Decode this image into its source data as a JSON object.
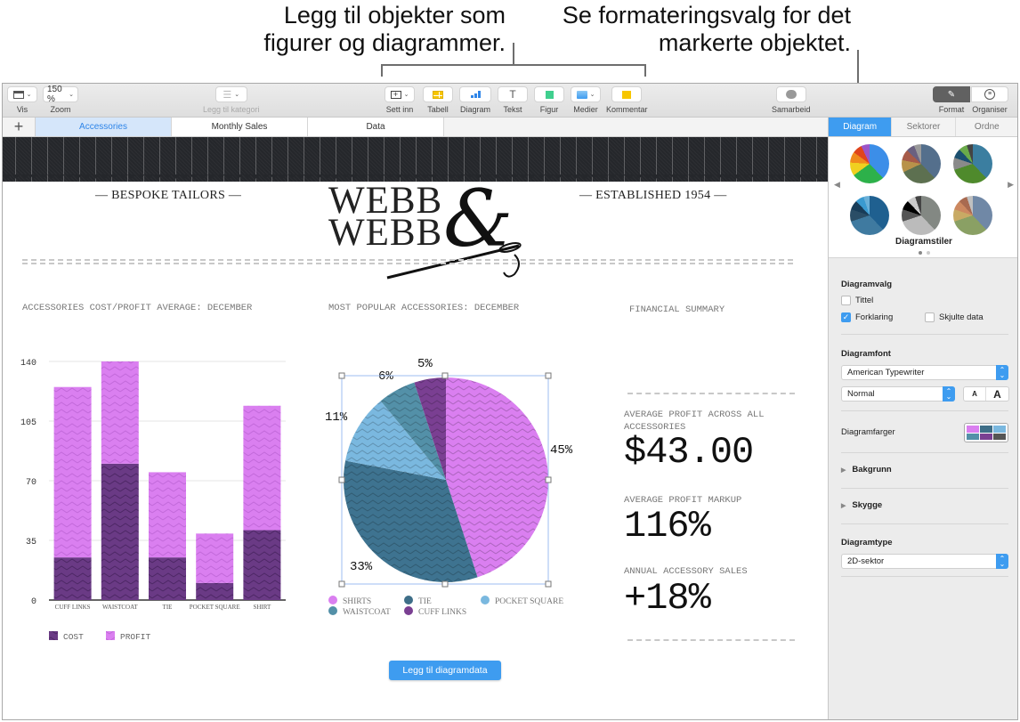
{
  "callouts": {
    "left_line1": "Legg til objekter som",
    "left_line2": "figurer og diagrammer.",
    "right_line1": "Se formateringsvalg for det",
    "right_line2": "markerte objektet."
  },
  "toolbar": {
    "view": {
      "label": "Vis",
      "icon": "sidebar-view-icon"
    },
    "zoom": {
      "label": "Zoom",
      "value": "150 %"
    },
    "category": {
      "label": "Legg til kategori",
      "icon": "list-icon"
    },
    "insert": {
      "label": "Sett inn",
      "icon": "insert-icon"
    },
    "table": {
      "label": "Tabell",
      "icon": "table-icon"
    },
    "chart": {
      "label": "Diagram",
      "icon": "bar-chart-icon"
    },
    "text": {
      "label": "Tekst",
      "icon": "text-icon",
      "glyph": "T"
    },
    "shape": {
      "label": "Figur",
      "icon": "shape-icon"
    },
    "media": {
      "label": "Medier",
      "icon": "media-icon"
    },
    "comment": {
      "label": "Kommentar",
      "icon": "comment-icon"
    },
    "collaborate": {
      "label": "Samarbeid",
      "icon": "collaborate-icon"
    },
    "format": {
      "label": "Format",
      "icon": "paintbrush-icon"
    },
    "organize": {
      "label": "Organiser",
      "icon": "organize-icon"
    }
  },
  "sheet_tabs": {
    "add": "+",
    "tabs": [
      {
        "label": "Accessories",
        "active": true
      },
      {
        "label": "Monthly Sales",
        "active": false
      },
      {
        "label": "Data",
        "active": false
      }
    ]
  },
  "document": {
    "tagline_left": "— BESPOKE TAILORS —",
    "tagline_right": "— ESTABLISHED 1954 —",
    "logo_line1": "WEBB",
    "logo_line2": "WEBB",
    "logo_amp": "&",
    "bar_chart_title": "ACCESSORIES COST/PROFIT AVERAGE: DECEMBER",
    "pie_chart_title": "MOST POPULAR ACCESSORIES: DECEMBER",
    "financial_title": "FINANCIAL SUMMARY",
    "financial": [
      {
        "label": "AVERAGE PROFIT ACROSS ALL ACCESSORIES",
        "value": "$43.00"
      },
      {
        "label": "AVERAGE PROFIT MARKUP",
        "value": "116%"
      },
      {
        "label": "ANNUAL ACCESSORY SALES",
        "value": "+18%"
      }
    ],
    "add_chart_data_button": "Legg til diagramdata"
  },
  "chart_data": [
    {
      "type": "bar",
      "stacked": true,
      "title": "ACCESSORIES COST/PROFIT AVERAGE: DECEMBER",
      "categories": [
        "CUFF LINKS",
        "WAISTCOAT",
        "TIE",
        "POCKET SQUARE",
        "SHIRT"
      ],
      "series": [
        {
          "name": "COST",
          "values": [
            25,
            80,
            25,
            10,
            41
          ],
          "color": "#6a3a85"
        },
        {
          "name": "PROFIT",
          "values": [
            100,
            60,
            50,
            29,
            73
          ],
          "color": "#da7ff0"
        }
      ],
      "yticks": [
        "0",
        "35",
        "70",
        "105",
        "140"
      ],
      "ylim": [
        0,
        140
      ],
      "grid": true,
      "legend": "bottom-left"
    },
    {
      "type": "pie",
      "title": "MOST POPULAR ACCESSORIES: DECEMBER",
      "slices": [
        {
          "name": "SHIRTS",
          "value": 45,
          "label": "45%",
          "color": "#da7ff0"
        },
        {
          "name": "WAISTCOAT",
          "value": 33,
          "label": "33%",
          "color": "#3e7390"
        },
        {
          "name": "POCKET SQUARE",
          "value": 11,
          "label": "11%",
          "color": "#7ab8df"
        },
        {
          "name": "TIE",
          "value": 6,
          "label": "6%",
          "color": "#5390a8"
        },
        {
          "name": "CUFF LINKS",
          "value": 5,
          "label": "5%",
          "color": "#7a3f92"
        }
      ],
      "legend_order": [
        {
          "name": "SHIRTS",
          "color": "#da7ff0"
        },
        {
          "name": "TIE",
          "color": "#3e6e88"
        },
        {
          "name": "POCKET SQUARE",
          "color": "#7ab8df"
        },
        {
          "name": "WAISTCOAT",
          "color": "#5390a8"
        },
        {
          "name": "CUFF LINKS",
          "color": "#7a3f92"
        }
      ],
      "legend": "bottom"
    }
  ],
  "inspector": {
    "tabs": [
      {
        "label": "Diagram",
        "active": true
      },
      {
        "label": "Sektorer",
        "active": false
      },
      {
        "label": "Ordne",
        "active": false
      }
    ],
    "styles_label": "Diagramstiler",
    "chart_options": {
      "heading": "Diagramvalg",
      "title": {
        "label": "Tittel",
        "checked": false
      },
      "legend": {
        "label": "Forklaring",
        "checked": true
      },
      "hidden_data": {
        "label": "Skjulte data",
        "checked": false
      }
    },
    "chart_font": {
      "heading": "Diagramfont",
      "font": "American Typewriter",
      "style": "Normal",
      "smaller": "A",
      "larger": "A"
    },
    "chart_colors": {
      "label": "Diagramfarger",
      "swatches": [
        "#da7ff0",
        "#3e6e88",
        "#7ab8df",
        "#5390a8",
        "#7a3f92",
        "#555555"
      ]
    },
    "background": "Bakgrunn",
    "shadow": "Skygge",
    "chart_type": {
      "heading": "Diagramtype",
      "value": "2D-sektor"
    }
  }
}
